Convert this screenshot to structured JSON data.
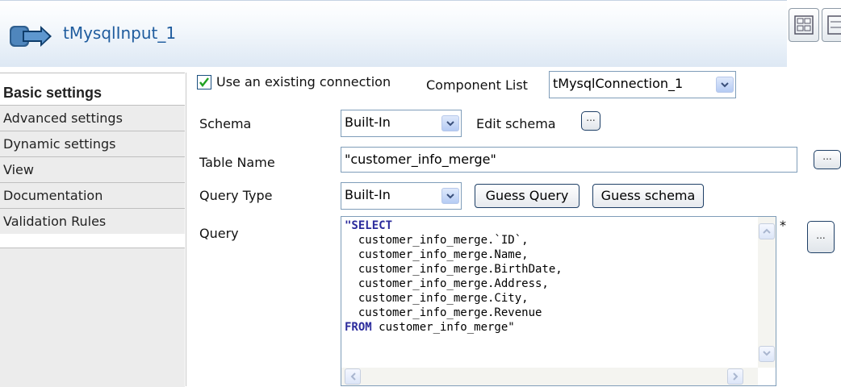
{
  "header": {
    "title": "tMysqlInput_1"
  },
  "tabs": [
    {
      "label": "Basic settings"
    },
    {
      "label": "Advanced settings"
    },
    {
      "label": "Dynamic settings"
    },
    {
      "label": "View"
    },
    {
      "label": "Documentation"
    },
    {
      "label": "Validation Rules"
    }
  ],
  "form": {
    "use_existing_label": "Use an existing connection",
    "use_existing_checked": true,
    "component_list_label": "Component List",
    "component_list_value": "tMysqlConnection_1",
    "schema_label": "Schema",
    "schema_value": "Built-In",
    "edit_schema_label": "Edit schema",
    "table_name_label": "Table Name",
    "table_name_value": "\"customer_info_merge\"",
    "query_type_label": "Query Type",
    "query_type_value": "Built-In",
    "guess_query_label": "Guess Query",
    "guess_schema_label": "Guess schema",
    "query_label": "Query",
    "query_modified_marker": "*",
    "query_lines": [
      {
        "kw": "\"SELECT",
        "text": ""
      },
      {
        "kw": "",
        "text": "  customer_info_merge.`ID`,"
      },
      {
        "kw": "",
        "text": "  customer_info_merge.Name,"
      },
      {
        "kw": "",
        "text": "  customer_info_merge.BirthDate,"
      },
      {
        "kw": "",
        "text": "  customer_info_merge.Address,"
      },
      {
        "kw": "",
        "text": "  customer_info_merge.City,"
      },
      {
        "kw": "",
        "text": "  customer_info_merge.Revenue"
      },
      {
        "kw": "FROM",
        "text": " customer_info_merge\""
      }
    ],
    "ellipsis": "..."
  }
}
